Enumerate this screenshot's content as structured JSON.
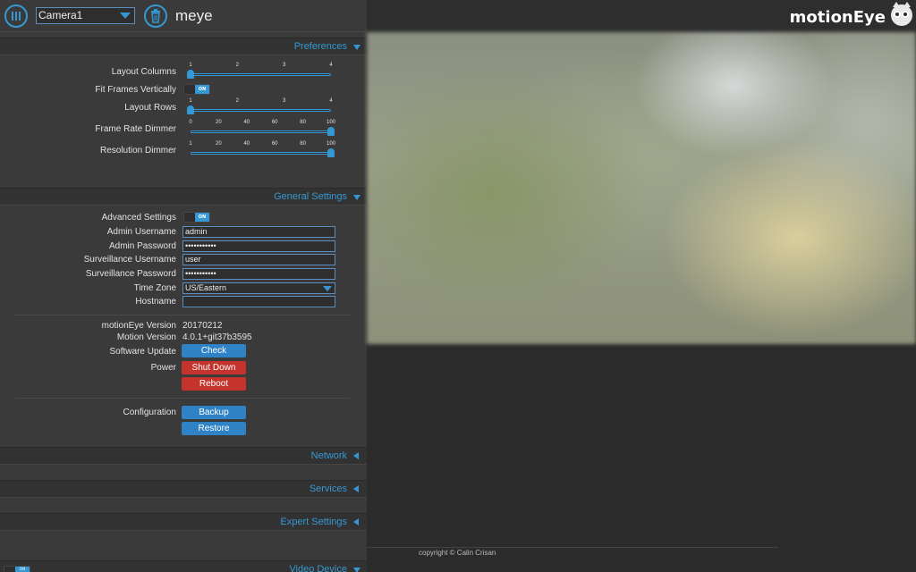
{
  "topbar": {
    "camera_select": "Camera1",
    "app_title": "meye",
    "brand": "motionEye"
  },
  "preferences": {
    "header": "Preferences",
    "layout_columns": {
      "label": "Layout Columns",
      "ticks": [
        "1",
        "2",
        "3",
        "4"
      ],
      "value": 1
    },
    "fit_frames": {
      "label": "Fit Frames Vertically",
      "toggle": "ON"
    },
    "layout_rows": {
      "label": "Layout Rows",
      "ticks": [
        "1",
        "2",
        "3",
        "4"
      ],
      "value": 1
    },
    "frame_rate_dimmer": {
      "label": "Frame Rate Dimmer",
      "ticks": [
        "0",
        "20",
        "40",
        "60",
        "80",
        "100"
      ],
      "value": 100
    },
    "resolution_dimmer": {
      "label": "Resolution Dimmer",
      "ticks": [
        "1",
        "20",
        "40",
        "60",
        "80",
        "100"
      ],
      "value": 100
    }
  },
  "general": {
    "header": "General Settings",
    "advanced_settings": {
      "label": "Advanced Settings",
      "toggle": "ON"
    },
    "admin_username": {
      "label": "Admin Username",
      "value": "admin"
    },
    "admin_password": {
      "label": "Admin Password",
      "value": "•••••••••••"
    },
    "surveillance_username": {
      "label": "Surveillance Username",
      "value": "user"
    },
    "surveillance_password": {
      "label": "Surveillance Password",
      "value": "•••••••••••"
    },
    "time_zone": {
      "label": "Time Zone",
      "value": "US/Eastern"
    },
    "hostname": {
      "label": "Hostname",
      "value": ""
    },
    "motioneye_version": {
      "label": "motionEye Version",
      "value": "20170212"
    },
    "motion_version": {
      "label": "Motion Version",
      "value": "4.0.1+git37b3595"
    },
    "software_update": {
      "label": "Software Update",
      "button": "Check"
    },
    "power": {
      "label": "Power",
      "shutdown": "Shut Down",
      "reboot": "Reboot"
    },
    "configuration": {
      "label": "Configuration",
      "backup": "Backup",
      "restore": "Restore"
    }
  },
  "sections": {
    "network": "Network",
    "services": "Services",
    "expert": "Expert Settings",
    "video_device": "Video Device"
  },
  "bottom_toggle": "ON",
  "footer": {
    "copyright": "copyright © Calin Crisan"
  },
  "colors": {
    "accent": "#3598d4",
    "danger": "#c4342d",
    "button": "#3082c6"
  }
}
